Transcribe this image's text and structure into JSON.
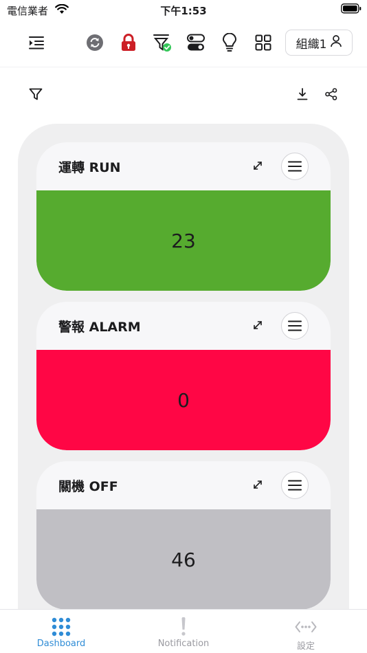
{
  "status_bar": {
    "carrier": "電信業者",
    "time": "下午1:53"
  },
  "toolbar": {
    "icons": [
      "menu-indent-icon",
      "sync-icon",
      "lock-icon",
      "filter-check-icon",
      "toggle-icon",
      "lightbulb-icon",
      "grid-icon"
    ],
    "org_label": "組織1"
  },
  "sub_toolbar": {
    "icons": [
      "filter-icon",
      "download-icon",
      "share-icon"
    ]
  },
  "cards": [
    {
      "title": "運轉 RUN",
      "value": "23",
      "color": "#56ab2f"
    },
    {
      "title": "警報 ALARM",
      "value": "0",
      "color": "#ff0645"
    },
    {
      "title": "關機 OFF",
      "value": "46",
      "color": "#c0bfc4"
    }
  ],
  "tabbar": {
    "tabs": [
      {
        "label": "Dashboard",
        "icon": "grid-dots-icon",
        "active": true
      },
      {
        "label": "Notification",
        "icon": "exclamation-icon",
        "active": false
      },
      {
        "label": "設定",
        "icon": "code-dots-icon",
        "active": false
      }
    ],
    "active_color": "#2f8cd6",
    "inactive_color": "#9a9aa0"
  }
}
